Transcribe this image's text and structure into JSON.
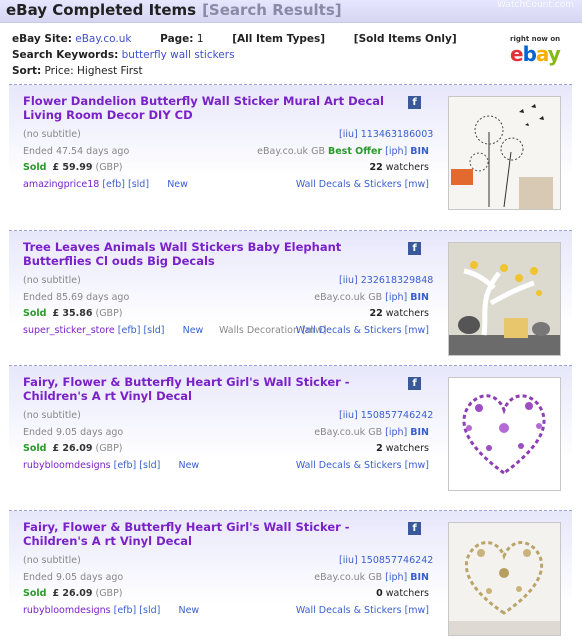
{
  "header": {
    "title": "eBay Completed Items",
    "subtitle": "[Search Results]",
    "watermark": "WatchCount.com"
  },
  "search_info": {
    "site_label": "eBay Site:",
    "site_value": "eBay.co.uk",
    "page_label": "Page:",
    "page_value": "1",
    "item_types": "[All Item Types]",
    "sold_only": "[Sold Items Only]",
    "keywords_label": "Search Keywords:",
    "keywords_value": "butterfly wall stickers",
    "sort_label": "Sort:",
    "sort_value": "Price: Highest First"
  },
  "ebay_logo": {
    "tagline": "right now on",
    "letters": [
      "e",
      "b",
      "a",
      "y"
    ]
  },
  "listings": [
    {
      "title": "Flower Dandelion Butterfly Wall Sticker Mural Art Decal Living Room Decor DIY CD",
      "subtitle": "(no subtitle)",
      "iiu": "[iiu]",
      "item_id": "113463186003",
      "ended": "Ended 47.54 days ago",
      "site": "eBay.co.uk",
      "country": "GB",
      "format": "Best Offer",
      "iph": "[iph]",
      "bin": "BIN",
      "sold_label": "Sold",
      "price": "£ 59.99",
      "currency": "(GBP)",
      "watchers_count": "22",
      "watchers_label": "watchers",
      "seller": "amazingprice18",
      "efb": "[efb]",
      "sld": "[sld]",
      "condition": "New",
      "extra_category": "",
      "category": "Wall Decals & Stickers",
      "mw": "[mw]"
    },
    {
      "title": "Tree Leaves Animals Wall Stickers Baby Elephant Butterflies Cl ouds Big Decals",
      "subtitle": "(no subtitle)",
      "iiu": "[iiu]",
      "item_id": "232618329848",
      "ended": "Ended 85.69 days ago",
      "site": "eBay.co.uk",
      "country": "GB",
      "format": "",
      "iph": "[iph]",
      "bin": "BIN",
      "sold_label": "Sold",
      "price": "£ 35.86",
      "currency": "(GBP)",
      "watchers_count": "22",
      "watchers_label": "watchers",
      "seller": "super_sticker_store",
      "efb": "[efb]",
      "sld": "[sld]",
      "condition": "New",
      "extra_category": "Walls Decoration [mw]",
      "category": "Wall Decals & Stickers",
      "mw": "[mw]"
    },
    {
      "title": "Fairy, Flower & Butterfly Heart Girl's Wall Sticker - Children's A rt Vinyl Decal",
      "subtitle": "(no subtitle)",
      "iiu": "[iiu]",
      "item_id": "150857746242",
      "ended": "Ended 9.05 days ago",
      "site": "eBay.co.uk",
      "country": "GB",
      "format": "",
      "iph": "[iph]",
      "bin": "BIN",
      "sold_label": "Sold",
      "price": "£ 26.09",
      "currency": "(GBP)",
      "watchers_count": "2",
      "watchers_label": "watchers",
      "seller": "rubybloomdesigns",
      "efb": "[efb]",
      "sld": "[sld]",
      "condition": "New",
      "extra_category": "",
      "category": "Wall Decals & Stickers",
      "mw": "[mw]"
    },
    {
      "title": "Fairy, Flower & Butterfly Heart Girl's Wall Sticker - Children's A rt Vinyl Decal",
      "subtitle": "(no subtitle)",
      "iiu": "[iiu]",
      "item_id": "150857746242",
      "ended": "Ended 9.05 days ago",
      "site": "eBay.co.uk",
      "country": "GB",
      "format": "",
      "iph": "[iph]",
      "bin": "BIN",
      "sold_label": "Sold",
      "price": "£ 26.09",
      "currency": "(GBP)",
      "watchers_count": "0",
      "watchers_label": "watchers",
      "seller": "rubybloomdesigns",
      "efb": "[efb]",
      "sld": "[sld]",
      "condition": "New",
      "extra_category": "",
      "category": "Wall Decals & Stickers",
      "mw": "[mw]"
    }
  ],
  "colors": {
    "title_purple": "#7a22c8",
    "link_blue": "#3a5fcd",
    "sold_green": "#2a9a2a",
    "header_bg": "#d6d6f2"
  }
}
